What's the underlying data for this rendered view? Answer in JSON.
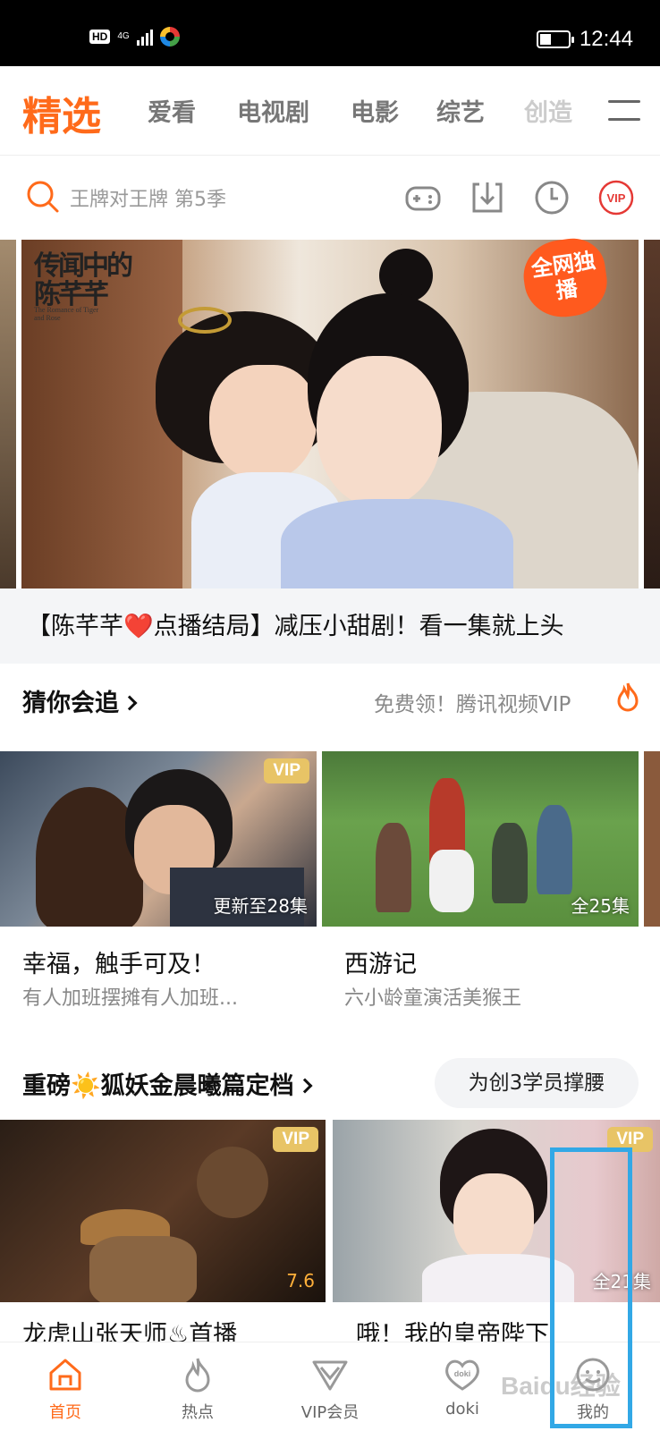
{
  "status_bar": {
    "hd": "HD",
    "network": "4G",
    "time": "12:44"
  },
  "top_tabs": {
    "active": "精选",
    "items": [
      "爱看",
      "电视剧",
      "电影",
      "综艺",
      "创造"
    ]
  },
  "search": {
    "placeholder": "王牌对王牌 第5季"
  },
  "toolbar_icons": [
    "gamepad-icon",
    "download-icon",
    "history-icon",
    "vip-icon"
  ],
  "banner": {
    "logo_cn": "传闻中的陈芊芊",
    "logo_en": "The Romance of Tiger and Rose",
    "badge": "全网独播",
    "caption": "【陈芊芊❤️点播结局】减压小甜剧！看一集就上头"
  },
  "section1": {
    "title": "猜你会追",
    "promo": "免费领！腾讯视频VIP",
    "cards": [
      {
        "tag": "VIP",
        "episodes": "更新至28集",
        "title": "幸福，触手可及！",
        "subtitle": "有人加班摆摊有人加班..."
      },
      {
        "tag": "",
        "episodes": "全25集",
        "title": "西游记",
        "subtitle": "六小龄童演活美猴王"
      }
    ]
  },
  "section2": {
    "title": "重磅☀️狐妖金晨曦篇定档",
    "pill": "为创3学员撑腰",
    "cards": [
      {
        "tag": "VIP",
        "score": "7.6",
        "title": "龙虎山张天师♨首播"
      },
      {
        "tag": "VIP",
        "episodes": "全21集",
        "title": "哦！我的皇帝陛下"
      }
    ]
  },
  "bottom_nav": [
    {
      "label": "首页",
      "icon": "home-icon",
      "active": true
    },
    {
      "label": "热点",
      "icon": "flame-icon",
      "active": false
    },
    {
      "label": "VIP会员",
      "icon": "vip-crown-icon",
      "active": false
    },
    {
      "label": "doki",
      "icon": "doki-heart-icon",
      "active": false
    },
    {
      "label": "我的",
      "icon": "profile-face-icon",
      "active": false
    }
  ],
  "colors": {
    "accent": "#ff6a1a",
    "vip_gold": "#e8c466",
    "highlight": "#32a8e6"
  },
  "watermark": "Baidu经验"
}
